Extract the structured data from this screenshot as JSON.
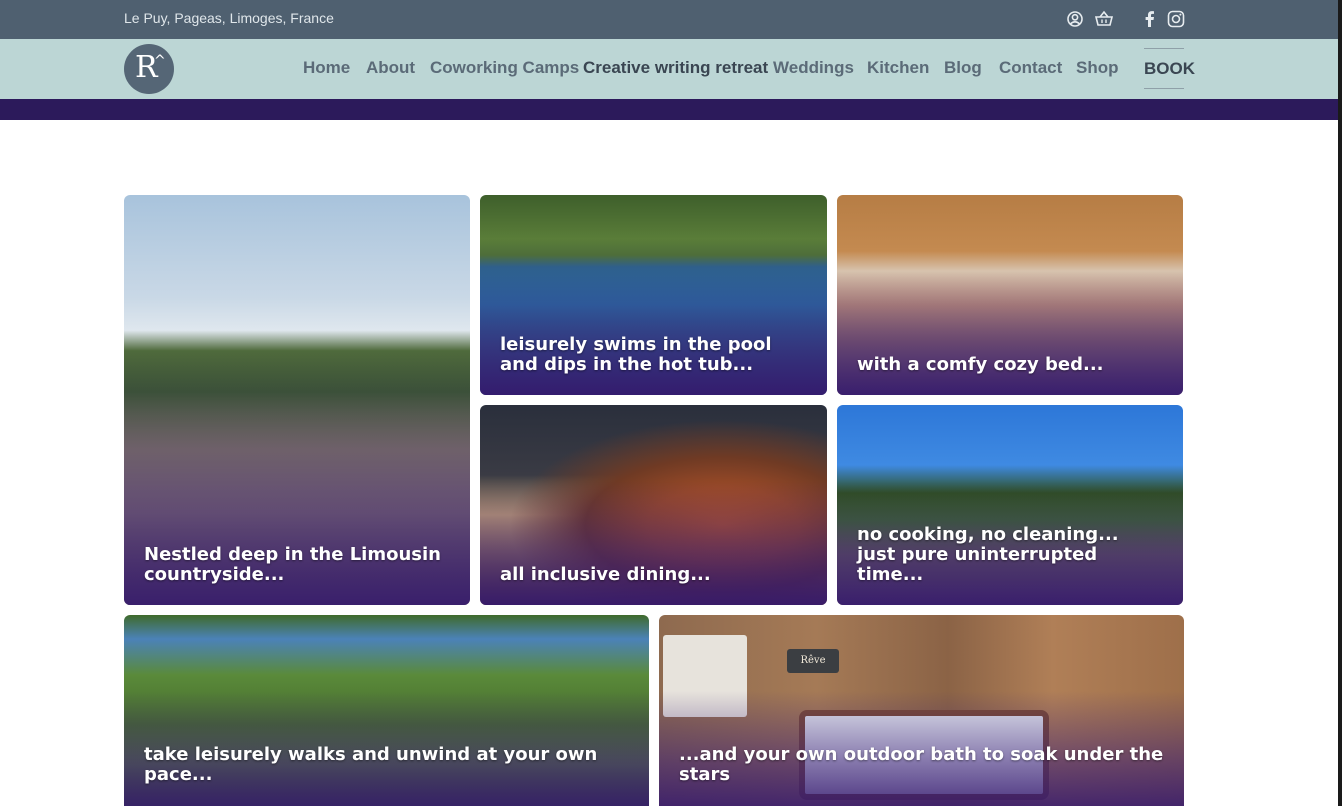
{
  "topbar": {
    "location": "Le Puy, Pageas, Limoges, France",
    "icons": [
      "user-icon",
      "basket-icon",
      "facebook-icon",
      "instagram-icon"
    ]
  },
  "nav": {
    "logo_letter": "R",
    "logo_mark": "^",
    "items": [
      {
        "label": "Home"
      },
      {
        "label": "About"
      },
      {
        "label": "Coworking Camps"
      },
      {
        "label": "Creative writing retreat"
      },
      {
        "label": "Weddings"
      },
      {
        "label": "Kitchen"
      },
      {
        "label": "Blog"
      },
      {
        "label": "Contact"
      },
      {
        "label": "Shop"
      }
    ],
    "book_label": "BOOK"
  },
  "gallery": {
    "cards": [
      {
        "caption": "Nestled deep in the Limousin countryside..."
      },
      {
        "caption": "leisurely swims in the pool and dips in the hot tub..."
      },
      {
        "caption": "with a comfy cozy bed..."
      },
      {
        "caption": "all inclusive dining..."
      },
      {
        "caption": "no cooking, no cleaning... just pure uninterrupted time..."
      },
      {
        "caption": "take leisurely walks and unwind at your own pace..."
      },
      {
        "caption": "...and your own outdoor bath to soak under the stars"
      }
    ],
    "sign_text": "Rêve"
  },
  "colors": {
    "topbar": "#4f6070",
    "nav": "#bcd6d5",
    "band": "#2c1a5b",
    "caption_overlay": "#3a1e76"
  }
}
